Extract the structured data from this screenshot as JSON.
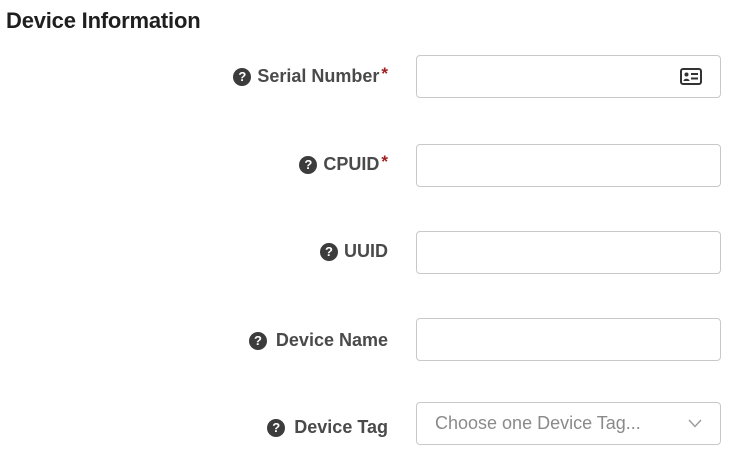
{
  "section": {
    "title": "Device Information"
  },
  "fields": {
    "serial_number": {
      "label": "Serial Number",
      "required_mark": "*",
      "value": "",
      "icon": "id-card-icon"
    },
    "cpuid": {
      "label": "CPUID",
      "required_mark": "*",
      "value": ""
    },
    "uuid": {
      "label": "UUID",
      "value": ""
    },
    "device_name": {
      "label": "Device Name",
      "value": ""
    },
    "device_tag": {
      "label": "Device Tag",
      "placeholder": "Choose one Device Tag...",
      "icon": "chevron-down-icon"
    }
  },
  "help_icon_glyph": "?",
  "colors": {
    "required": "#a31d1d",
    "help_icon_bg": "#3c3c3c",
    "border": "#c9c9c9"
  }
}
